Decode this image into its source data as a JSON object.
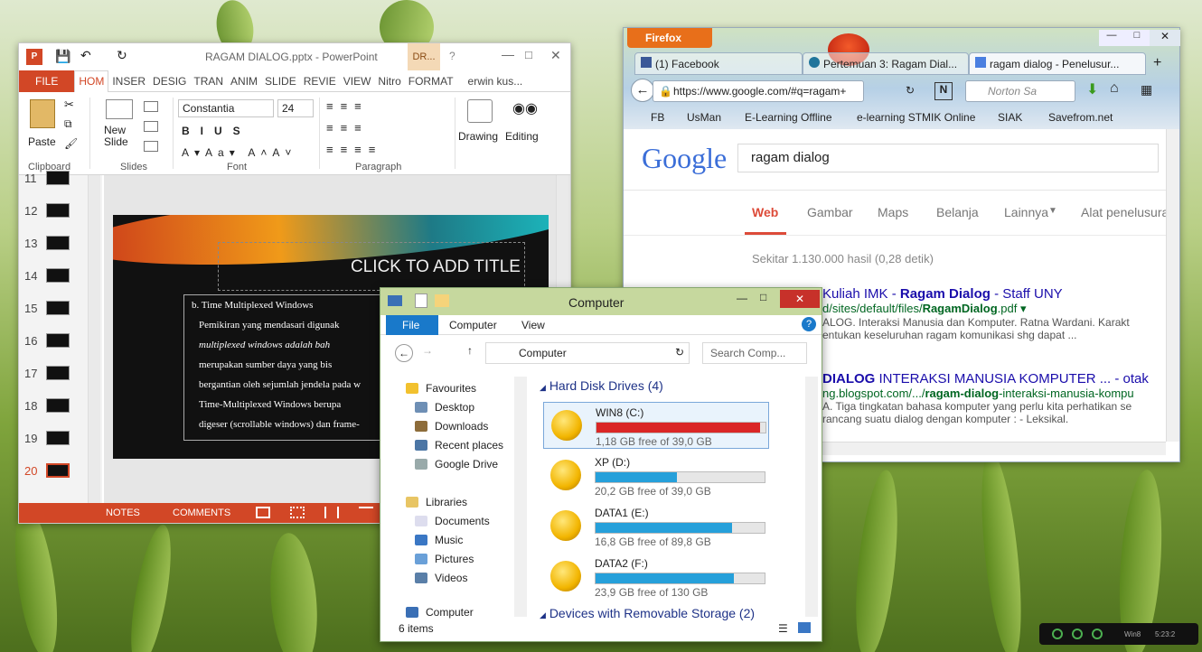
{
  "powerpoint": {
    "title": "RAGAM DIALOG.pptx - PowerPoint",
    "context_tab": "DR...",
    "tabs": [
      "FILE",
      "HOM",
      "INSER",
      "DESIG",
      "TRAN",
      "ANIM",
      "SLIDE",
      "REVIE",
      "VIEW",
      "Nitro",
      "FORMAT"
    ],
    "user": "erwin kus...",
    "font_name": "Constantia",
    "font_size": "24",
    "paste": "Paste",
    "new_slide": "New Slide",
    "drawing": "Drawing",
    "editing": "Editing",
    "groups": [
      "Clipboard",
      "Slides",
      "Font",
      "Paragraph"
    ],
    "slide_numbers": [
      "11",
      "12",
      "13",
      "14",
      "15",
      "16",
      "17",
      "18",
      "19",
      "20"
    ],
    "slide_title": "CLICK TO ADD TITLE",
    "body_heading": "b.  Time Multiplexed Windows",
    "body_lines": [
      "Pemikiran yang mendasari digunak",
      "multiplexed windows adalah bah",
      "merupakan sumber daya yang bis",
      "bergantian oleh sejumlah jendela pada w",
      "Time-Multiplexed Windows berupa",
      "digeser (scrollable windows) dan frame-"
    ],
    "notes": "NOTES",
    "comments": "COMMENTS"
  },
  "firefox": {
    "menu": "Firefox",
    "tabs": [
      "(1) Facebook",
      "Pertemuan 3: Ragam Dial...",
      "ragam dialog - Penelusur..."
    ],
    "url": "https://www.google.com/#q=ragam+",
    "search_engine": "Norton Sa",
    "bookmarks": [
      "FB",
      "UsMan",
      "E-Learning Offline",
      "e-learning STMIK Online",
      "SIAK",
      "Savefrom.net"
    ],
    "google_logo": "Google",
    "query": "ragam dialog",
    "search_tabs": [
      "Web",
      "Gambar",
      "Maps",
      "Belanja",
      "Lainnya",
      "Alat penelusura"
    ],
    "result_count": "Sekitar 1.130.000 hasil (0,28 detik)",
    "results": [
      {
        "title_pre": "Kuliah IMK - ",
        "title_bold": "Ragam Dialog",
        "title_post": " - Staff UNY",
        "url_pre": "d/sites/default/files/",
        "url_bold": "RagamDialog",
        "url_post": ".pdf",
        "snippet1": "ALOG. Interaksi Manusia dan Komputer. Ratna Wardani. Karakt",
        "snippet2": "entukan keseluruhan ragam komunikasi shg dapat ..."
      },
      {
        "title_pre": "",
        "title_bold": "DIALOG",
        "title_post": " INTERAKSI MANUSIA KOMPUTER ... - otak",
        "url_pre": "ng.blogspot.com/.../",
        "url_bold": "ragam-dialog",
        "url_post": "-interaksi-manusia-kompu",
        "snippet1": "A. Tiga tingkatan bahasa komputer yang perlu kita perhatikan se",
        "snippet2": "rancang suatu dialog dengan komputer : - Leksikal."
      }
    ]
  },
  "explorer": {
    "title": "Computer",
    "ribbon_tabs": [
      "File",
      "Computer",
      "View"
    ],
    "address": "Computer",
    "search_placeholder": "Search Comp...",
    "nav": [
      "Favourites",
      "Desktop",
      "Downloads",
      "Recent places",
      "Google Drive",
      "Libraries",
      "Documents",
      "Music",
      "Pictures",
      "Videos",
      "Computer"
    ],
    "section_title": "Hard Disk Drives (4)",
    "section2": "Devices with Removable Storage (2)",
    "drives": [
      {
        "name": "WIN8 (C:)",
        "free": "1,18 GB free of 39,0 GB",
        "used": 0.97,
        "color": "#da2626"
      },
      {
        "name": "XP (D:)",
        "free": "20,2 GB free of 39,0 GB",
        "used": 0.48,
        "color": "#26a0da"
      },
      {
        "name": "DATA1 (E:)",
        "free": "16,8 GB free of 89,8 GB",
        "used": 0.81,
        "color": "#26a0da"
      },
      {
        "name": "DATA2 (F:)",
        "free": "23,9 GB free of 130 GB",
        "used": 0.82,
        "color": "#26a0da"
      }
    ],
    "status": "6 items"
  },
  "gadget": {
    "label": "Win8",
    "time": "5:23:2"
  }
}
